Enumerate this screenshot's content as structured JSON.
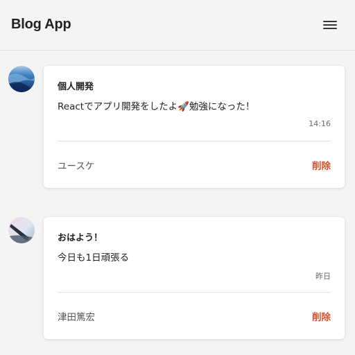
{
  "app": {
    "title": "Blog App",
    "menu_icon": "hamburger-menu-icon"
  },
  "colors": {
    "background": "#f4f4f5",
    "card": "#ffffff",
    "delete": "#d94f2a",
    "muted_text": "#555555"
  },
  "posts": [
    {
      "title": "個人開発",
      "body": "Reactでアプリ開発をしたよ🚀勉強になった！",
      "time": "14:16",
      "author": "ユースケ",
      "delete_label": "削除",
      "avatar": "ocean-wave-avatar"
    },
    {
      "title": "おはよう！",
      "body": "今日も1日頑張る",
      "time": "昨日",
      "author": "津田篤宏",
      "delete_label": "削除",
      "avatar": "sky-photo-avatar"
    }
  ]
}
